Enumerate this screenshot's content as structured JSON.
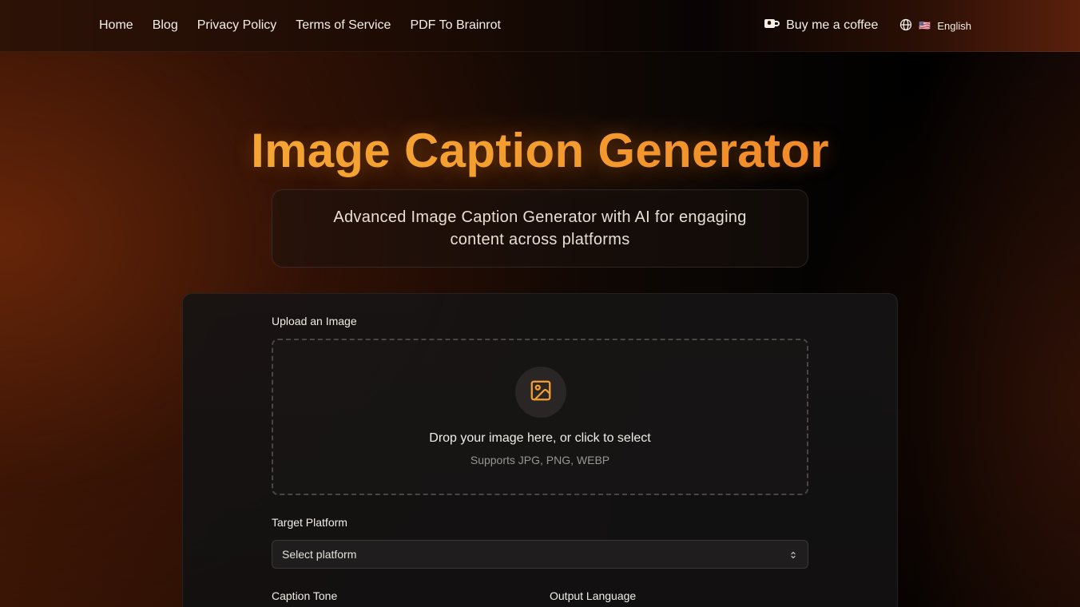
{
  "nav": {
    "items": [
      "Home",
      "Blog",
      "Privacy Policy",
      "Terms of Service",
      "PDF To Brainrot"
    ],
    "coffee_label": "Buy me a coffee",
    "coffee_icon": "coffee-cup-icon",
    "language_icon": "globe-icon",
    "language_flag": "🇺🇸",
    "language_label": "English"
  },
  "hero": {
    "title": "Image Caption Generator",
    "subtitle": "Advanced Image Caption Generator with AI for engaging content across platforms"
  },
  "form": {
    "upload_label": "Upload an Image",
    "upload_icon": "image-icon",
    "drop_text": "Drop your image here, or click to select",
    "drop_hint": "Supports JPG, PNG, WEBP",
    "platform_label": "Target Platform",
    "platform_value": "Select platform",
    "tone_label": "Caption Tone",
    "language_label": "Output Language"
  },
  "colors": {
    "accent": "#f5a030",
    "accent_end": "#f0782a",
    "background": "#0a0604"
  }
}
